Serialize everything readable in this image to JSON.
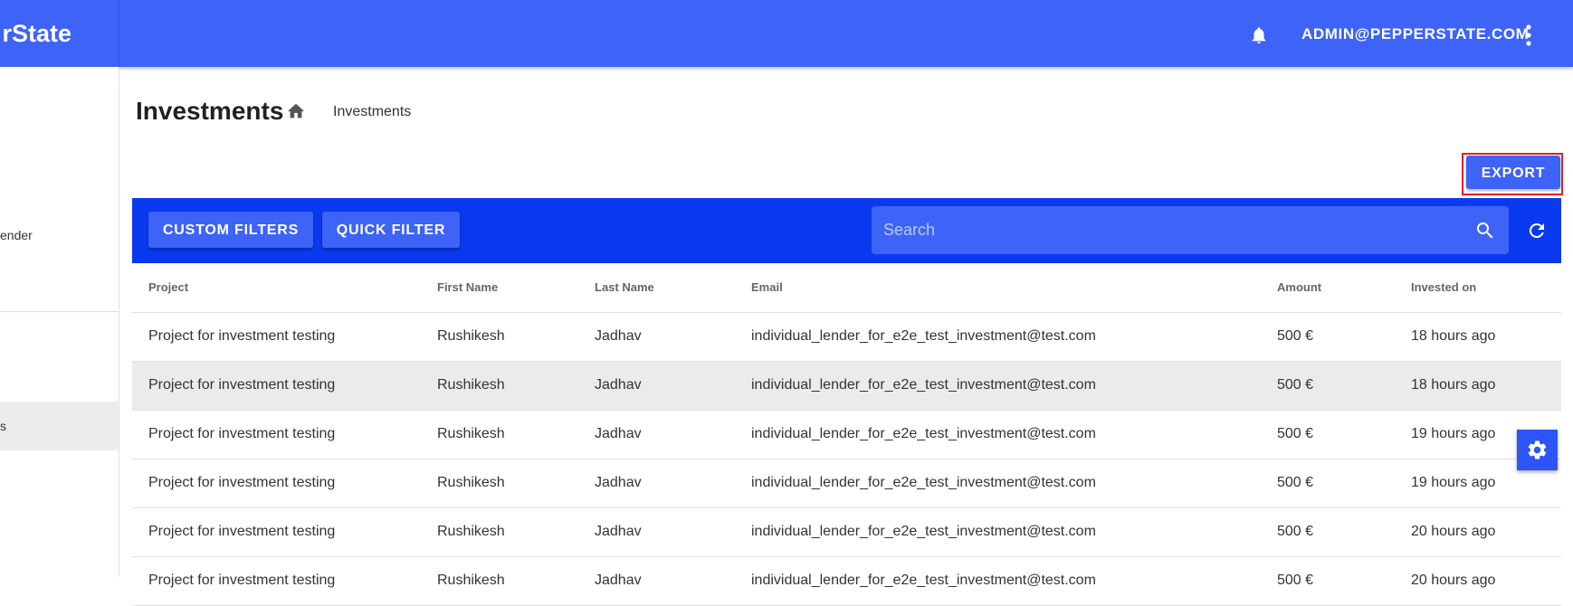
{
  "appbar": {
    "brand": "rState",
    "user_email": "ADMIN@PEPPERSTATE.COM",
    "icons": [
      "bell-icon",
      "kebab-menu-icon"
    ]
  },
  "sidebar": {
    "item_partial_lender": "ender",
    "item_partial_active": "s"
  },
  "page": {
    "title": "Investments",
    "breadcrumb": "Investments",
    "export_label": "EXPORT"
  },
  "toolbar": {
    "custom_filters_label": "CUSTOM FILTERS",
    "quick_filter_label": "QUICK FILTER",
    "search_placeholder": "Search"
  },
  "table": {
    "columns": [
      "Project",
      "First Name",
      "Last Name",
      "Email",
      "Amount",
      "Invested on"
    ],
    "rows": [
      [
        "Project for investment testing",
        "Rushikesh",
        "Jadhav",
        "individual_lender_for_e2e_test_investment@test.com",
        "500 €",
        "18 hours ago"
      ],
      [
        "Project for investment testing",
        "Rushikesh",
        "Jadhav",
        "individual_lender_for_e2e_test_investment@test.com",
        "500 €",
        "18 hours ago"
      ],
      [
        "Project for investment testing",
        "Rushikesh",
        "Jadhav",
        "individual_lender_for_e2e_test_investment@test.com",
        "500 €",
        "19 hours ago"
      ],
      [
        "Project for investment testing",
        "Rushikesh",
        "Jadhav",
        "individual_lender_for_e2e_test_investment@test.com",
        "500 €",
        "19 hours ago"
      ],
      [
        "Project for investment testing",
        "Rushikesh",
        "Jadhav",
        "individual_lender_for_e2e_test_investment@test.com",
        "500 €",
        "20 hours ago"
      ],
      [
        "Project for investment testing",
        "Rushikesh",
        "Jadhav",
        "individual_lender_for_e2e_test_investment@test.com",
        "500 €",
        "20 hours ago"
      ]
    ]
  },
  "colors": {
    "appbar": "#3d63f7",
    "toolbar": "#0a3aef",
    "highlight_border": "#e41e2b"
  }
}
